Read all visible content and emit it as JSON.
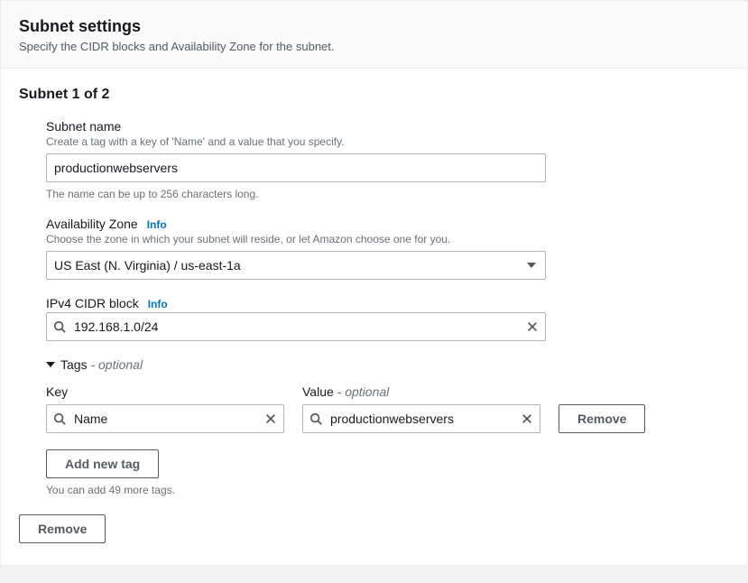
{
  "header": {
    "title": "Subnet settings",
    "subtitle": "Specify the CIDR blocks and Availability Zone for the subnet."
  },
  "section": {
    "title": "Subnet 1 of 2"
  },
  "subnet_name": {
    "label": "Subnet name",
    "description": "Create a tag with a key of 'Name' and a value that you specify.",
    "value": "productionwebservers",
    "hint": "The name can be up to 256 characters long."
  },
  "availability_zone": {
    "label": "Availability Zone",
    "info": "Info",
    "description": "Choose the zone in which your subnet will reside, or let Amazon choose one for you.",
    "value": "US East (N. Virginia) / us-east-1a"
  },
  "cidr": {
    "label": "IPv4 CIDR block",
    "info": "Info",
    "value": "192.168.1.0/24"
  },
  "tags": {
    "toggle_label": "Tags",
    "optional": "- optional",
    "key_label": "Key",
    "value_label": "Value",
    "value_optional": "- optional",
    "key_value": "Name",
    "value_value": "productionwebservers",
    "remove_label": "Remove",
    "add_label": "Add new tag",
    "hint": "You can add 49 more tags."
  },
  "remove_subnet_label": "Remove"
}
